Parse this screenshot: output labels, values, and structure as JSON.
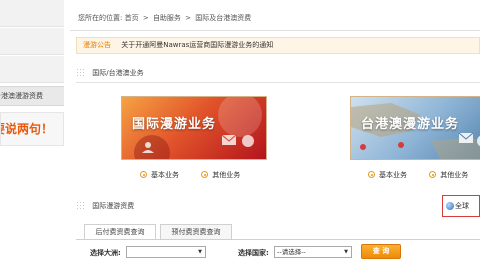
{
  "sidebar": {
    "active_item": "台港澳漫游资费",
    "promo_text": "要说两句！"
  },
  "breadcrumb": {
    "prefix": "您所在的位置:",
    "items": [
      "首页",
      "自助服务",
      "国际及台港澳资费"
    ],
    "separator": ">"
  },
  "notice": {
    "tag": "漫游公告",
    "message": "关于开通阿曼Nawras运营商国际漫游业务的通知"
  },
  "section_international": {
    "title": "国际/台港澳业务",
    "banners": [
      {
        "title": "国际漫游业务",
        "links": [
          "基本业务",
          "其他业务"
        ]
      },
      {
        "title": "台港澳漫游业务",
        "links": [
          "基本业务",
          "其他业务"
        ]
      }
    ]
  },
  "section_rates": {
    "title": "国际漫游资费",
    "global_box_label": "全球"
  },
  "tabs": {
    "items": [
      "后付费资费查询",
      "预付费资费查询"
    ],
    "active_index": 0
  },
  "form": {
    "continent_label": "选择大洲:",
    "continent_value": "",
    "country_label": "选择国家:",
    "country_value": "--请选择--",
    "query_button": "查 询"
  },
  "colors": {
    "accent_orange": "#ef8a08",
    "notice_tag": "#e67e00",
    "promo_text": "#e8590c",
    "highlight_border": "#d93a3a"
  }
}
